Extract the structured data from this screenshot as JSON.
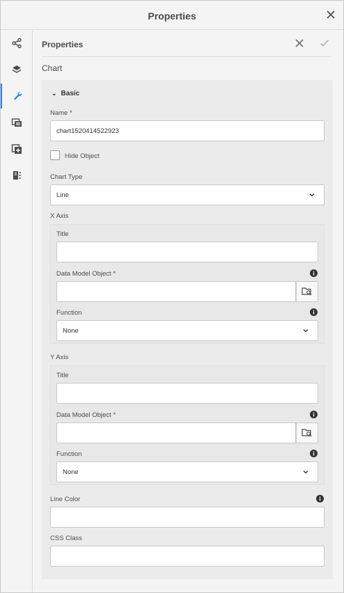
{
  "window": {
    "title": "Properties"
  },
  "icons": {
    "close": "close-icon",
    "rail": [
      "share-icon",
      "layers-icon",
      "wrench-icon",
      "data-icon",
      "add-object-icon",
      "layout-icon"
    ]
  },
  "panel": {
    "title": "Properties"
  },
  "object_type": "Chart",
  "basic": {
    "header": "Basic",
    "name_label": "Name *",
    "name_value": "chart1520414522923",
    "hide_object_label": "Hide Object",
    "chart_type_label": "Chart Type",
    "chart_type_value": "Line",
    "x_axis": {
      "label": "X Axis",
      "title_label": "Title",
      "title_value": "",
      "dmo_label": "Data Model Object *",
      "dmo_value": "",
      "function_label": "Function",
      "function_value": "None"
    },
    "y_axis": {
      "label": "Y Axis",
      "title_label": "Title",
      "title_value": "",
      "dmo_label": "Data Model Object *",
      "dmo_value": "",
      "function_label": "Function",
      "function_value": "None"
    },
    "line_color_label": "Line Color",
    "line_color_value": "",
    "css_class_label": "CSS Class",
    "css_class_value": ""
  },
  "colors": {
    "accent": "#2680eb",
    "background": "#f4f4f4",
    "group": "#ebebeb"
  }
}
